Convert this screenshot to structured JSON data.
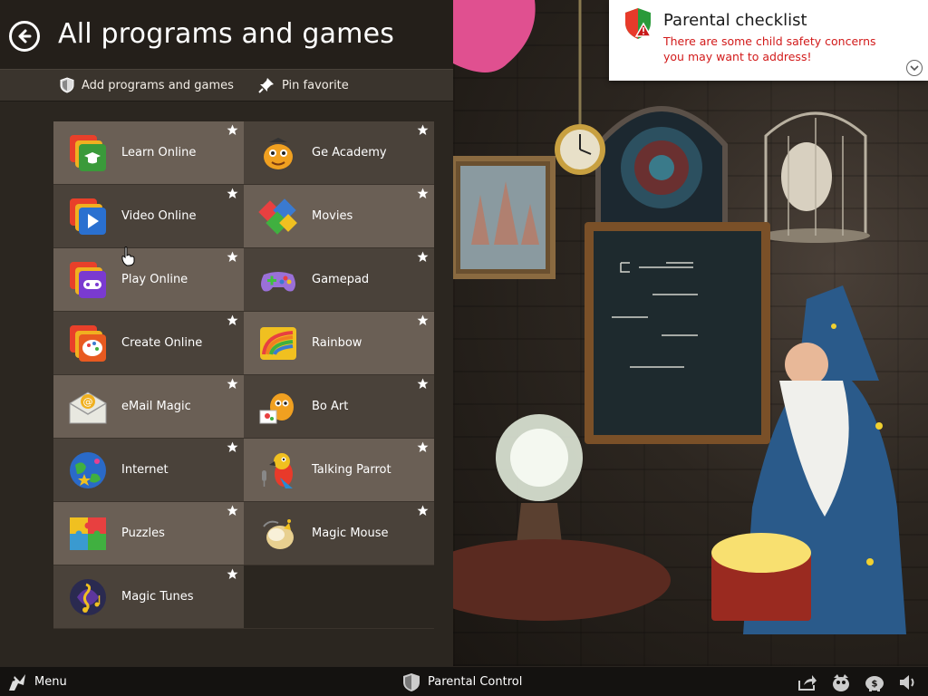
{
  "header": {
    "title": "All programs and games",
    "back_icon": "back-arrow-icon"
  },
  "toolbar": {
    "add_label": "Add programs and games",
    "pin_label": "Pin favorite"
  },
  "tiles": [
    {
      "label": "Learn Online",
      "icon": "learn-online-icon"
    },
    {
      "label": "Ge Academy",
      "icon": "ge-academy-icon"
    },
    {
      "label": "Video Online",
      "icon": "video-online-icon"
    },
    {
      "label": "Movies",
      "icon": "movies-icon"
    },
    {
      "label": "Play Online",
      "icon": "play-online-icon"
    },
    {
      "label": "Gamepad",
      "icon": "gamepad-icon"
    },
    {
      "label": "Create Online",
      "icon": "create-online-icon"
    },
    {
      "label": "Rainbow",
      "icon": "rainbow-icon"
    },
    {
      "label": "eMail Magic",
      "icon": "email-magic-icon"
    },
    {
      "label": "Bo Art",
      "icon": "bo-art-icon"
    },
    {
      "label": "Internet",
      "icon": "internet-icon"
    },
    {
      "label": "Talking Parrot",
      "icon": "talking-parrot-icon"
    },
    {
      "label": "Puzzles",
      "icon": "puzzles-icon"
    },
    {
      "label": "Magic Mouse",
      "icon": "magic-mouse-icon"
    },
    {
      "label": "Magic Tunes",
      "icon": "magic-tunes-icon"
    }
  ],
  "notification": {
    "title": "Parental checklist",
    "message": "There are some child safety concerns you may want to address!"
  },
  "taskbar": {
    "menu_label": "Menu",
    "parental_label": "Parental Control"
  },
  "colors": {
    "panel_bg": "#2b2620",
    "tile_light": "#6a5f55",
    "tile_dark": "#4a423a",
    "alert_red": "#d21a1a"
  }
}
